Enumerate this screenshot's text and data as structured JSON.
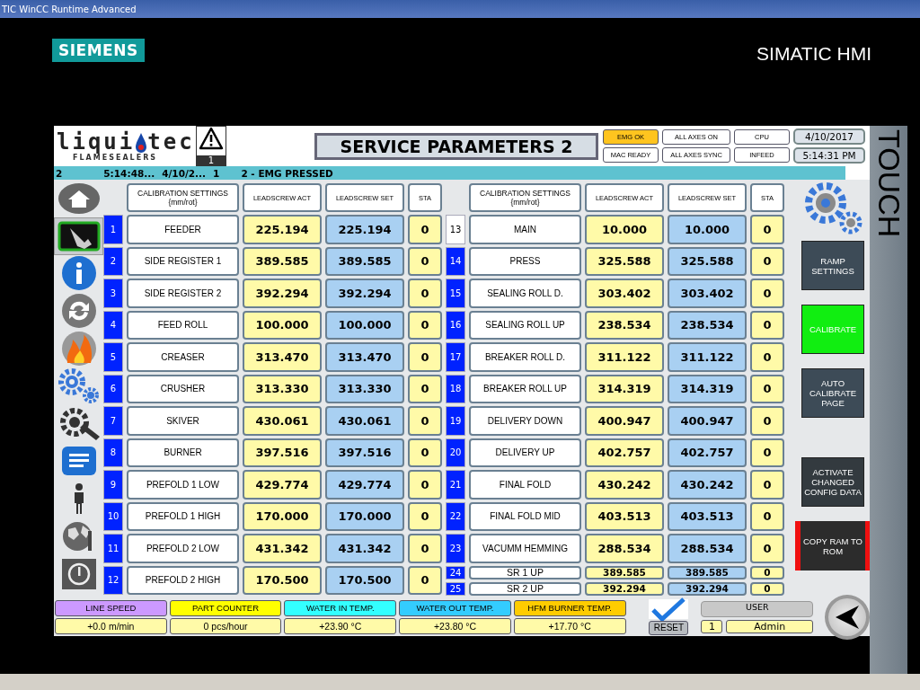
{
  "window": {
    "title": "TIC WinCC Runtime Advanced"
  },
  "brand": {
    "logo": "SIEMENS",
    "product": "SIMATIC HMI",
    "side_label": "TOUCH"
  },
  "header": {
    "logo_start": "liqui",
    "logo_end": "tec",
    "logo_sub": "FLAMESEALERS",
    "alarm_count": "1",
    "title": "SERVICE PARAMETERS 2",
    "status": [
      {
        "label": "EMG OK",
        "on": true
      },
      {
        "label": "ALL AXES ON",
        "on": false
      },
      {
        "label": "CPU",
        "on": false
      },
      {
        "label": "MAC READY",
        "on": false
      },
      {
        "label": "ALL AXES SYNC",
        "on": false
      },
      {
        "label": "INFEED",
        "on": false
      }
    ],
    "date": "4/10/2017",
    "time": "5:14:31 PM"
  },
  "alarm_bar": {
    "fields": [
      "2",
      "5:14:48...",
      "4/10/2...",
      "1",
      "2 - EMG PRESSED"
    ]
  },
  "sidebar": {
    "items": [
      {
        "kind": "home",
        "selected": false
      },
      {
        "kind": "touch",
        "selected": true
      },
      {
        "kind": "info",
        "selected": false
      },
      {
        "kind": "refresh",
        "selected": false
      },
      {
        "kind": "flame",
        "selected": false
      },
      {
        "kind": "gears",
        "selected": false
      },
      {
        "kind": "tools",
        "selected": false
      },
      {
        "kind": "list",
        "selected": false
      },
      {
        "kind": "person",
        "selected": false
      },
      {
        "kind": "globe",
        "selected": false
      },
      {
        "kind": "power",
        "selected": false
      }
    ]
  },
  "left_table": {
    "columns": [
      "CALIBRATION SETTINGS {mm/rot}",
      "LEADSCREW ACT",
      "LEADSCREW SET",
      "STA"
    ],
    "rows": [
      {
        "no": "1",
        "name": "FEEDER",
        "act": "225.194",
        "set": "225.194",
        "sta": "0",
        "selected": false
      },
      {
        "no": "2",
        "name": "SIDE REGISTER 1",
        "act": "389.585",
        "set": "389.585",
        "sta": "0",
        "selected": false
      },
      {
        "no": "3",
        "name": "SIDE REGISTER 2",
        "act": "392.294",
        "set": "392.294",
        "sta": "0",
        "selected": false
      },
      {
        "no": "4",
        "name": "FEED ROLL",
        "act": "100.000",
        "set": "100.000",
        "sta": "0",
        "selected": false
      },
      {
        "no": "5",
        "name": "CREASER",
        "act": "313.470",
        "set": "313.470",
        "sta": "0",
        "selected": false
      },
      {
        "no": "6",
        "name": "CRUSHER",
        "act": "313.330",
        "set": "313.330",
        "sta": "0",
        "selected": false
      },
      {
        "no": "7",
        "name": "SKIVER",
        "act": "430.061",
        "set": "430.061",
        "sta": "0",
        "selected": false
      },
      {
        "no": "8",
        "name": "BURNER",
        "act": "397.516",
        "set": "397.516",
        "sta": "0",
        "selected": false
      },
      {
        "no": "9",
        "name": "PREFOLD 1 LOW",
        "act": "429.774",
        "set": "429.774",
        "sta": "0",
        "selected": false
      },
      {
        "no": "10",
        "name": "PREFOLD 1 HIGH",
        "act": "170.000",
        "set": "170.000",
        "sta": "0",
        "selected": false
      },
      {
        "no": "11",
        "name": "PREFOLD 2 LOW",
        "act": "431.342",
        "set": "431.342",
        "sta": "0",
        "selected": false
      },
      {
        "no": "12",
        "name": "PREFOLD 2 HIGH",
        "act": "170.500",
        "set": "170.500",
        "sta": "0",
        "selected": false
      }
    ]
  },
  "right_table": {
    "columns": [
      "CALIBRATION SETTINGS {mm/rot}",
      "LEADSCREW ACT",
      "LEADSCREW SET",
      "STA"
    ],
    "rows": [
      {
        "no": "13",
        "name": "MAIN",
        "act": "10.000",
        "set": "10.000",
        "sta": "0",
        "selected": true
      },
      {
        "no": "14",
        "name": "PRESS",
        "act": "325.588",
        "set": "325.588",
        "sta": "0",
        "selected": false
      },
      {
        "no": "15",
        "name": "SEALING ROLL D.",
        "act": "303.402",
        "set": "303.402",
        "sta": "0",
        "selected": false
      },
      {
        "no": "16",
        "name": "SEALING ROLL UP",
        "act": "238.534",
        "set": "238.534",
        "sta": "0",
        "selected": false
      },
      {
        "no": "17",
        "name": "BREAKER ROLL D.",
        "act": "311.122",
        "set": "311.122",
        "sta": "0",
        "selected": false
      },
      {
        "no": "18",
        "name": "BREAKER ROLL UP",
        "act": "314.319",
        "set": "314.319",
        "sta": "0",
        "selected": false
      },
      {
        "no": "19",
        "name": "DELIVERY DOWN",
        "act": "400.947",
        "set": "400.947",
        "sta": "0",
        "selected": false
      },
      {
        "no": "20",
        "name": "DELIVERY UP",
        "act": "402.757",
        "set": "402.757",
        "sta": "0",
        "selected": false
      },
      {
        "no": "21",
        "name": "FINAL FOLD",
        "act": "430.242",
        "set": "430.242",
        "sta": "0",
        "selected": false
      },
      {
        "no": "22",
        "name": "FINAL FOLD MID",
        "act": "403.513",
        "set": "403.513",
        "sta": "0",
        "selected": false
      },
      {
        "no": "23",
        "name": "VACUMM HEMMING",
        "act": "288.534",
        "set": "288.534",
        "sta": "0",
        "selected": false
      }
    ],
    "half_rows": [
      {
        "no": "24",
        "name": "SR 1 UP",
        "act": "389.585",
        "set": "389.585",
        "sta": "0",
        "selected": false
      },
      {
        "no": "25",
        "name": "SR 2 UP",
        "act": "392.294",
        "set": "392.294",
        "sta": "0",
        "selected": false
      }
    ]
  },
  "actions": [
    {
      "label": "RAMP SETTINGS",
      "kind": "slate"
    },
    {
      "label": "CALIBRATE",
      "kind": "green"
    },
    {
      "label": "AUTO CALIBRATE PAGE",
      "kind": "slate"
    },
    {
      "label": "ACTIVATE CHANGED CONFIG DATA",
      "kind": "dark"
    },
    {
      "label": "COPY RAM TO ROM",
      "kind": "red"
    }
  ],
  "footer": {
    "readouts": [
      {
        "label": "LINE SPEED",
        "value": "+0.0 m/min",
        "color": "#cc99ff"
      },
      {
        "label": "PART COUNTER",
        "value": "0 pcs/hour",
        "color": "#ffff00"
      },
      {
        "label": "WATER IN TEMP.",
        "value": "+23.90 °C",
        "color": "#33ffff"
      },
      {
        "label": "WATER OUT TEMP.",
        "value": "+23.80 °C",
        "color": "#33ccff"
      },
      {
        "label": "HFM BURNER TEMP.",
        "value": "+17.70 °C",
        "color": "#ffcc00"
      }
    ],
    "reset": {
      "label": "RESET",
      "checked": true
    },
    "user": {
      "label": "USER",
      "number": "1",
      "name": "Admin"
    }
  }
}
